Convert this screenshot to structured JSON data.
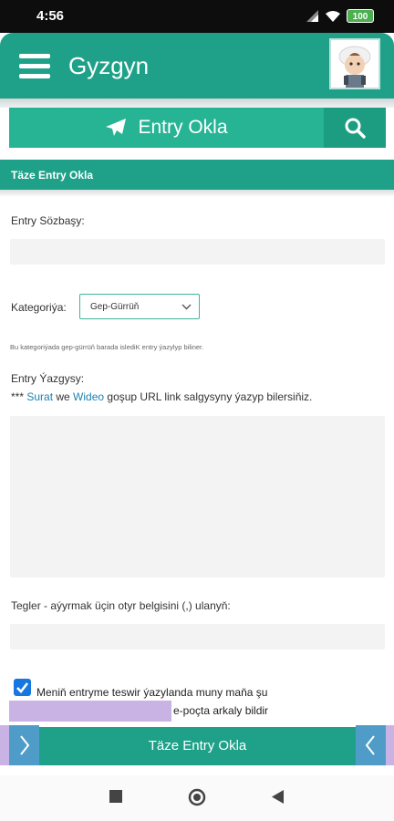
{
  "status_bar": {
    "time": "4:56",
    "battery": "100"
  },
  "header": {
    "app_name": "Gyzgyn"
  },
  "post_bar": {
    "label": "Entry Okla"
  },
  "section": {
    "title": "Täze Entry Okla"
  },
  "form": {
    "title_label": "Entry Sözbaşy:",
    "title_value": "",
    "category_label": "Kategoriýa:",
    "category_selected": "Gep-Gürrüň",
    "category_hint": "Bu kategoriýada gep-gürrüň barada islediK entry ýazylyp biliner.",
    "body_label": "Entry Ýazgysy:",
    "body_hint_prefix": "*** ",
    "body_hint_link1": "Surat",
    "body_hint_mid": " we ",
    "body_hint_link2": "Wideo",
    "body_hint_suffix": " goşup URL link salgysyny ýazyp bilersiňiz.",
    "body_value": "",
    "tags_label": "Tegler - aýyrmak üçin otyr belgisini (,) ulanyň:",
    "tags_value": "",
    "notify_checked": true,
    "notify_text_line1": "Meniň entryme teswir ýazylanda muny maňa şu",
    "notify_text_line2": "e-poçta arkaly bildir",
    "submit_label": "Täze Entry Okla"
  },
  "colors": {
    "brand": "#1fa189",
    "accent": "#27b494",
    "link": "#1b82b4"
  }
}
